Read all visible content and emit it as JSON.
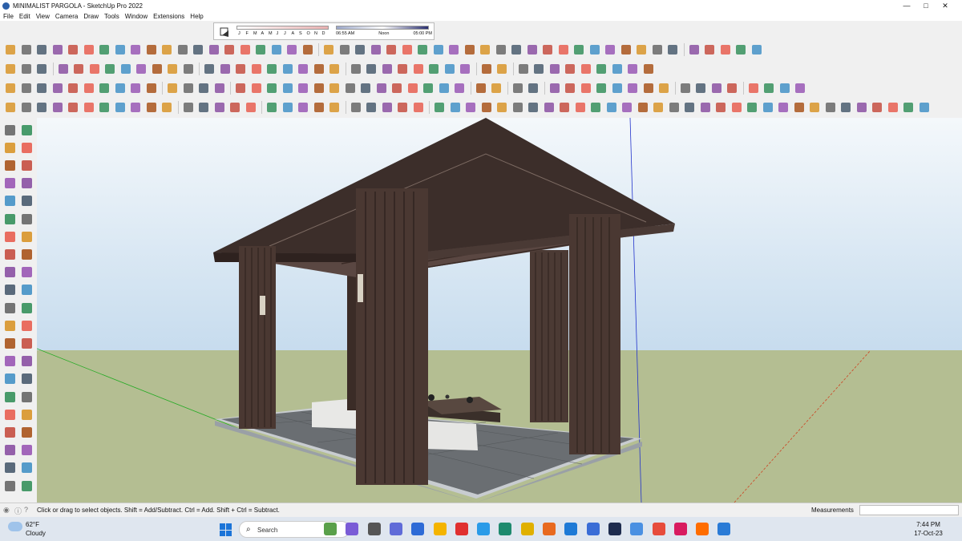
{
  "window": {
    "title": "MINIMALIST PARGOLA - SketchUp Pro 2022",
    "min": "—",
    "max": "□",
    "close": "✕"
  },
  "menu": [
    "File",
    "Edit",
    "View",
    "Camera",
    "Draw",
    "Tools",
    "Window",
    "Extensions",
    "Help"
  ],
  "shadows": {
    "months": [
      "J",
      "F",
      "M",
      "A",
      "M",
      "J",
      "J",
      "A",
      "S",
      "O",
      "N",
      "D"
    ],
    "time_start": "06:55 AM",
    "time_noon": "Noon",
    "time_end": "05:00 PM"
  },
  "status": {
    "hint": "Click or drag to select objects. Shift = Add/Subtract. Ctrl = Add. Shift + Ctrl = Subtract.",
    "measurements_label": "Measurements",
    "measurements_value": ""
  },
  "taskbar": {
    "temp": "62°F",
    "weather": "Cloudy",
    "search": "Search",
    "time": "7:44 PM",
    "date": "17-Oct-23"
  },
  "colors": {
    "sky": "#c8ddef",
    "ground": "#b4be92",
    "wood": "#4a3832",
    "floor": "#6a6e72",
    "axis_blue": "#2233cc",
    "axis_red": "#cc4422",
    "axis_green": "#22aa22"
  }
}
